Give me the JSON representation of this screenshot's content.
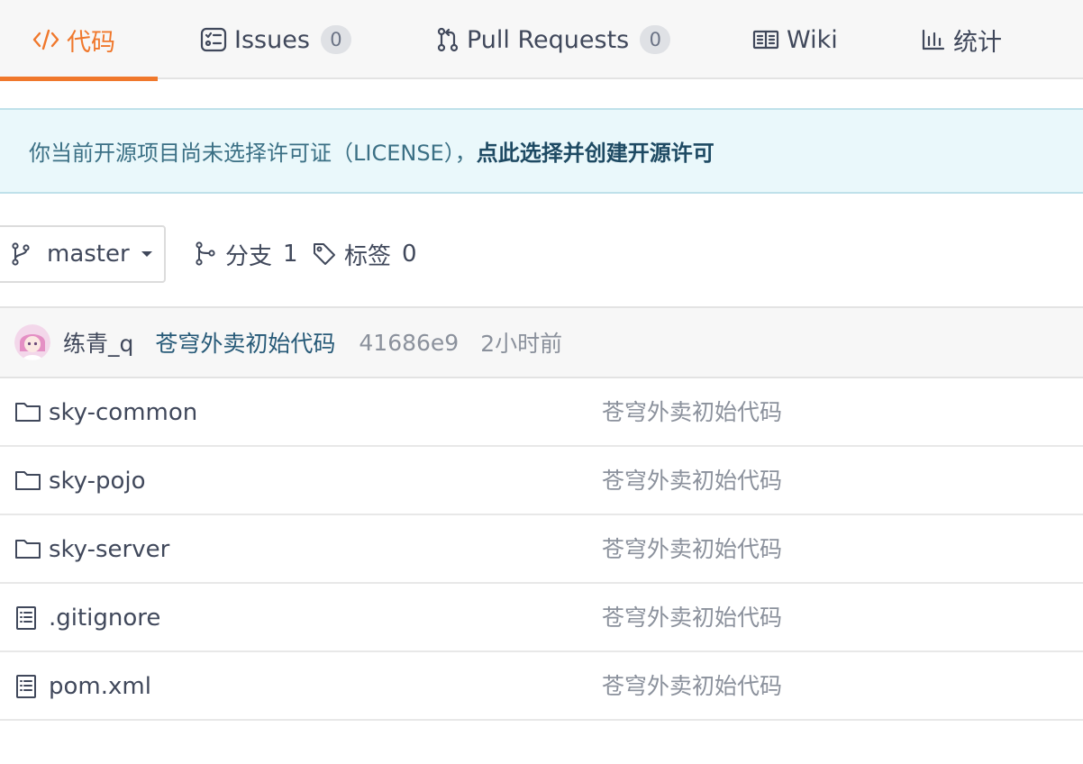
{
  "tabs": {
    "code": {
      "label": "代码"
    },
    "issues": {
      "label": "Issues",
      "count": "0"
    },
    "pull_requests": {
      "label": "Pull Requests",
      "count": "0"
    },
    "wiki": {
      "label": "Wiki"
    },
    "stats": {
      "label": "统计"
    }
  },
  "license_notice": {
    "text": "你当前开源项目尚未选择许可证（LICENSE），",
    "link": "点此选择并创建开源许可"
  },
  "branch_bar": {
    "current_branch": "master",
    "branches_label": "分支",
    "branches_count": "1",
    "tags_label": "标签",
    "tags_count": "0"
  },
  "commit": {
    "author": "练青_q",
    "message": "苍穹外卖初始代码",
    "sha": "41686e9",
    "time": "2小时前"
  },
  "files": [
    {
      "name": "sky-common",
      "type": "folder",
      "icon": "folder-icon",
      "message": "苍穹外卖初始代码"
    },
    {
      "name": "sky-pojo",
      "type": "folder",
      "icon": "folder-icon",
      "message": "苍穹外卖初始代码"
    },
    {
      "name": "sky-server",
      "type": "folder",
      "icon": "folder-icon",
      "message": "苍穹外卖初始代码"
    },
    {
      "name": ".gitignore",
      "type": "file",
      "icon": "file-icon",
      "message": "苍穹外卖初始代码"
    },
    {
      "name": "pom.xml",
      "type": "file",
      "icon": "file-icon",
      "message": "苍穹外卖初始代码"
    }
  ],
  "colors": {
    "accent": "#f0782c",
    "link": "#275a78",
    "notice_bg": "#eaf8fb"
  }
}
